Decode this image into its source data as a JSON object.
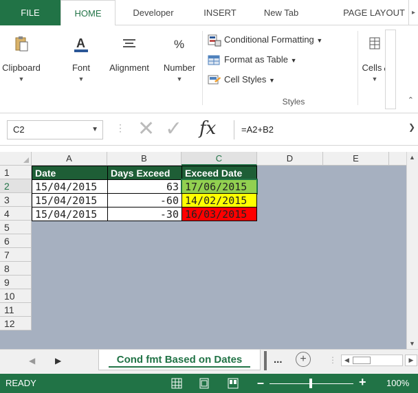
{
  "ribbon_tabs": [
    "FILE",
    "HOME",
    "Developer",
    "INSERT",
    "New Tab",
    "PAGE LAYOUT"
  ],
  "ribbon_groups": {
    "clipboard": "Clipboard",
    "font": "Font",
    "alignment": "Alignment",
    "number": "Number",
    "cells": "Cells",
    "styles": {
      "conditional_formatting": "Conditional Formatting",
      "format_as_table": "Format as Table",
      "cell_styles": "Cell Styles",
      "label": "Styles"
    }
  },
  "formula_bar": {
    "name_box": "C2",
    "formula": "=A2+B2"
  },
  "columns": [
    "A",
    "B",
    "C",
    "D",
    "E"
  ],
  "rows": [
    "1",
    "2",
    "3",
    "4",
    "5",
    "6",
    "7",
    "8",
    "9",
    "10",
    "11",
    "12"
  ],
  "table": {
    "headers": [
      "Date",
      "Days Exceed",
      "Exceed Date"
    ],
    "rows": [
      {
        "date": "15/04/2015",
        "days": "63",
        "exceed": "17/06/2015",
        "status_color": "#92d050"
      },
      {
        "date": "15/04/2015",
        "days": "-60",
        "exceed": "14/02/2015",
        "status_color": "#ffff00"
      },
      {
        "date": "15/04/2015",
        "days": "-30",
        "exceed": "16/03/2015",
        "status_color": "#ff0000"
      }
    ]
  },
  "sheet_tabs": {
    "active": "Cond fmt Based on Dates",
    "more": "..."
  },
  "status": {
    "text": "READY",
    "zoom": "100%"
  },
  "colors": {
    "accent": "#217346",
    "header_fill": "#1e5e36",
    "grid_background": "#a6b0c0"
  }
}
